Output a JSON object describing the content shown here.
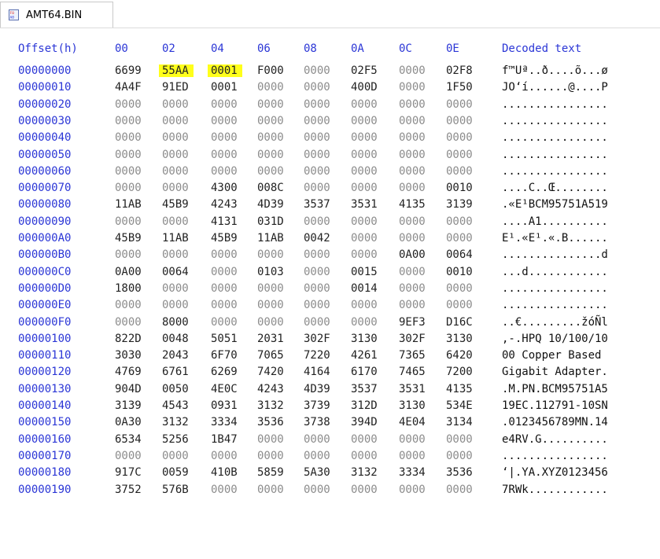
{
  "tab": {
    "label": "AMT64.BIN",
    "icon": "hex-file-icon"
  },
  "headers": {
    "offset": "Offset(h)",
    "columns": [
      "00",
      "02",
      "04",
      "06",
      "08",
      "0A",
      "0C",
      "0E"
    ],
    "decoded": "Decoded text"
  },
  "highlight_color": "#ffff1a",
  "rows": [
    {
      "offset": "00000000",
      "words": [
        "6699",
        "55AA",
        "0001",
        "F000",
        "0000",
        "02F5",
        "0000",
        "02F8"
      ],
      "decoded": "f™Uª..ð....õ...ø"
    },
    {
      "offset": "00000010",
      "words": [
        "4A4F",
        "91ED",
        "0001",
        "0000",
        "0000",
        "400D",
        "0000",
        "1F50"
      ],
      "decoded": "JO‘í......@....P"
    },
    {
      "offset": "00000020",
      "words": [
        "0000",
        "0000",
        "0000",
        "0000",
        "0000",
        "0000",
        "0000",
        "0000"
      ],
      "decoded": "................"
    },
    {
      "offset": "00000030",
      "words": [
        "0000",
        "0000",
        "0000",
        "0000",
        "0000",
        "0000",
        "0000",
        "0000"
      ],
      "decoded": "................"
    },
    {
      "offset": "00000040",
      "words": [
        "0000",
        "0000",
        "0000",
        "0000",
        "0000",
        "0000",
        "0000",
        "0000"
      ],
      "decoded": "................"
    },
    {
      "offset": "00000050",
      "words": [
        "0000",
        "0000",
        "0000",
        "0000",
        "0000",
        "0000",
        "0000",
        "0000"
      ],
      "decoded": "................"
    },
    {
      "offset": "00000060",
      "words": [
        "0000",
        "0000",
        "0000",
        "0000",
        "0000",
        "0000",
        "0000",
        "0000"
      ],
      "decoded": "................"
    },
    {
      "offset": "00000070",
      "words": [
        "0000",
        "0000",
        "4300",
        "008C",
        "0000",
        "0000",
        "0000",
        "0010"
      ],
      "decoded": "....C..Œ........"
    },
    {
      "offset": "00000080",
      "words": [
        "11AB",
        "45B9",
        "4243",
        "4D39",
        "3537",
        "3531",
        "4135",
        "3139"
      ],
      "decoded": ".«E¹BCM95751A519"
    },
    {
      "offset": "00000090",
      "words": [
        "0000",
        "0000",
        "4131",
        "031D",
        "0000",
        "0000",
        "0000",
        "0000"
      ],
      "decoded": "....A1.........."
    },
    {
      "offset": "000000A0",
      "words": [
        "45B9",
        "11AB",
        "45B9",
        "11AB",
        "0042",
        "0000",
        "0000",
        "0000"
      ],
      "decoded": "E¹.«E¹.«.B......"
    },
    {
      "offset": "000000B0",
      "words": [
        "0000",
        "0000",
        "0000",
        "0000",
        "0000",
        "0000",
        "0A00",
        "0064"
      ],
      "decoded": "...............d"
    },
    {
      "offset": "000000C0",
      "words": [
        "0A00",
        "0064",
        "0000",
        "0103",
        "0000",
        "0015",
        "0000",
        "0010"
      ],
      "decoded": "...d............"
    },
    {
      "offset": "000000D0",
      "words": [
        "1800",
        "0000",
        "0000",
        "0000",
        "0000",
        "0014",
        "0000",
        "0000"
      ],
      "decoded": "................"
    },
    {
      "offset": "000000E0",
      "words": [
        "0000",
        "0000",
        "0000",
        "0000",
        "0000",
        "0000",
        "0000",
        "0000"
      ],
      "decoded": "................"
    },
    {
      "offset": "000000F0",
      "words": [
        "0000",
        "8000",
        "0000",
        "0000",
        "0000",
        "0000",
        "9EF3",
        "D16C"
      ],
      "decoded": "..€.........žóÑl"
    },
    {
      "offset": "00000100",
      "words": [
        "822D",
        "0048",
        "5051",
        "2031",
        "302F",
        "3130",
        "302F",
        "3130"
      ],
      "decoded": ",-.HPQ 10/100/10"
    },
    {
      "offset": "00000110",
      "words": [
        "3030",
        "2043",
        "6F70",
        "7065",
        "7220",
        "4261",
        "7365",
        "6420"
      ],
      "decoded": "00 Copper Based "
    },
    {
      "offset": "00000120",
      "words": [
        "4769",
        "6761",
        "6269",
        "7420",
        "4164",
        "6170",
        "7465",
        "7200"
      ],
      "decoded": "Gigabit Adapter."
    },
    {
      "offset": "00000130",
      "words": [
        "904D",
        "0050",
        "4E0C",
        "4243",
        "4D39",
        "3537",
        "3531",
        "4135"
      ],
      "decoded": ".M.PN.BCM95751A5"
    },
    {
      "offset": "00000140",
      "words": [
        "3139",
        "4543",
        "0931",
        "3132",
        "3739",
        "312D",
        "3130",
        "534E"
      ],
      "decoded": "19EC.112791-10SN"
    },
    {
      "offset": "00000150",
      "words": [
        "0A30",
        "3132",
        "3334",
        "3536",
        "3738",
        "394D",
        "4E04",
        "3134"
      ],
      "decoded": ".0123456789MN.14"
    },
    {
      "offset": "00000160",
      "words": [
        "6534",
        "5256",
        "1B47",
        "0000",
        "0000",
        "0000",
        "0000",
        "0000"
      ],
      "decoded": "e4RV.G.........."
    },
    {
      "offset": "00000170",
      "words": [
        "0000",
        "0000",
        "0000",
        "0000",
        "0000",
        "0000",
        "0000",
        "0000"
      ],
      "decoded": "................"
    },
    {
      "offset": "00000180",
      "words": [
        "917C",
        "0059",
        "410B",
        "5859",
        "5A30",
        "3132",
        "3334",
        "3536"
      ],
      "decoded": "‘|.YA.XYZ0123456"
    },
    {
      "offset": "00000190",
      "words": [
        "3752",
        "576B",
        "0000",
        "0000",
        "0000",
        "0000",
        "0000",
        "0000"
      ],
      "decoded": "7RWk............"
    }
  ],
  "highlights": [
    {
      "row": 0,
      "col": 1
    },
    {
      "row": 0,
      "col": 2
    }
  ]
}
